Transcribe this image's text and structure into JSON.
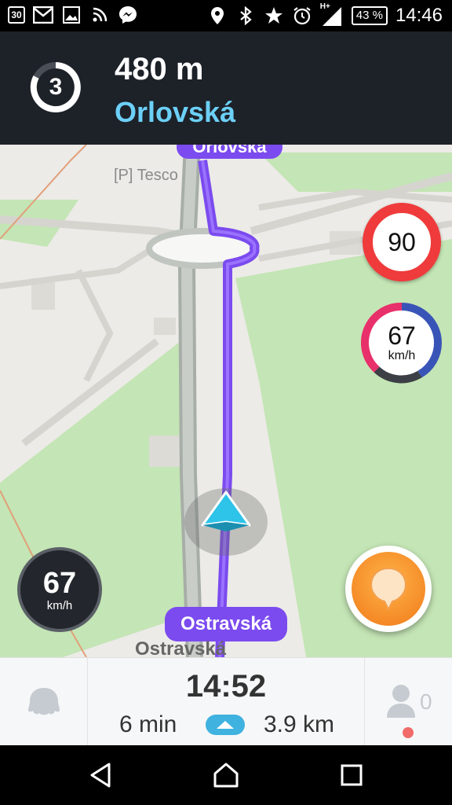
{
  "status_bar": {
    "calendar_day": "30",
    "network_type": "H+",
    "battery": "43 %",
    "time": "14:46",
    "icons_left": [
      "calendar-icon",
      "gmail-icon",
      "gallery-icon",
      "cast-icon",
      "messenger-icon"
    ],
    "icons_right": [
      "location-icon",
      "bluetooth-icon",
      "star-icon",
      "alarm-icon",
      "signal-icon",
      "battery-icon"
    ]
  },
  "navigation": {
    "exit_number": "3",
    "distance": "480 m",
    "street": "Orlovská",
    "maneuver_icon": "roundabout-exit-icon"
  },
  "map": {
    "poi_label": "[P] Tesco",
    "route_top_label": "Orlovská",
    "route_bottom_label": "Ostravská",
    "street_label": "Ostravská",
    "speed_limit": "90",
    "speedometer_value": "67",
    "speedometer_unit": "km/h",
    "current_speed": "67",
    "current_speed_unit": "km/h",
    "colors": {
      "route": "#7b4bef",
      "speed_limit_ring": "#ef3b3b",
      "header_bg": "#1d2128",
      "street_highlight": "#6cd0f7",
      "park": "#c4e5b5"
    }
  },
  "trip": {
    "eta": "14:52",
    "remaining_time": "6 min",
    "remaining_distance": "3.9 km",
    "friends_online": "0"
  },
  "android_nav": [
    "back-icon",
    "home-icon",
    "recents-icon"
  ]
}
